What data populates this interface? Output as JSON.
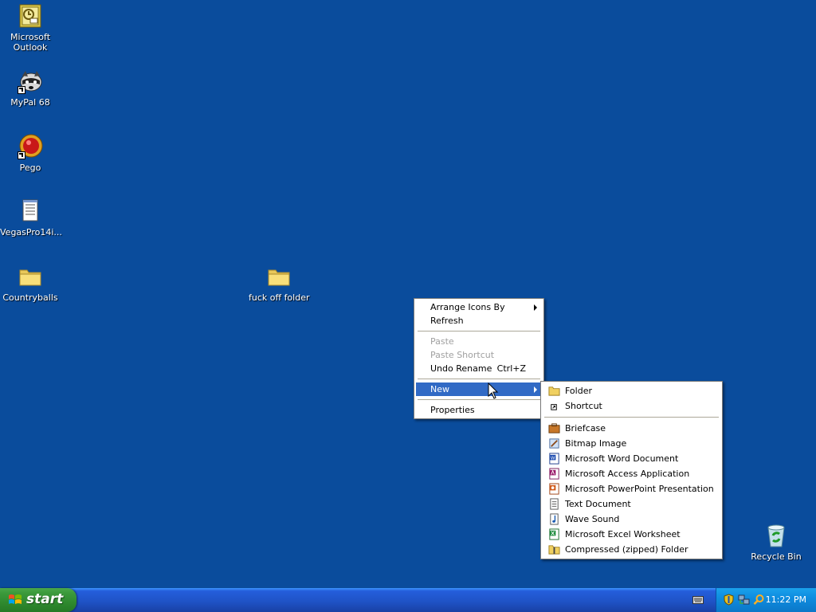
{
  "desktop": {
    "background": "#0a4c9c",
    "icons": [
      {
        "label_line1": "Microsoft",
        "label_line2": "Outlook",
        "icon": "outlook-icon"
      },
      {
        "label": "MyPal 68",
        "icon": "raccoon-icon"
      },
      {
        "label": "Pego",
        "icon": "pego-icon"
      },
      {
        "label": "VegasPro14i...",
        "icon": "text-file-icon"
      },
      {
        "label": "Countryballs",
        "icon": "folder-icon"
      },
      {
        "label": "fuck off folder",
        "icon": "folder-icon"
      },
      {
        "label": "Recycle Bin",
        "icon": "recycle-bin-icon"
      }
    ]
  },
  "context_menu": {
    "items": [
      {
        "label": "Arrange Icons By",
        "has_submenu": true
      },
      {
        "label": "Refresh"
      },
      {
        "label": "Paste",
        "disabled": true
      },
      {
        "label": "Paste Shortcut",
        "disabled": true
      },
      {
        "label": "Undo Rename",
        "shortcut": "Ctrl+Z"
      },
      {
        "label": "New",
        "has_submenu": true,
        "highlighted": true
      },
      {
        "label": "Properties"
      }
    ]
  },
  "new_submenu": {
    "items": [
      {
        "label": "Folder",
        "icon": "folder-icon"
      },
      {
        "label": "Shortcut",
        "icon": "shortcut-icon"
      },
      {
        "label": "Briefcase",
        "icon": "briefcase-icon"
      },
      {
        "label": "Bitmap Image",
        "icon": "bitmap-icon"
      },
      {
        "label": "Microsoft Word Document",
        "icon": "word-icon"
      },
      {
        "label": "Microsoft Access Application",
        "icon": "access-icon"
      },
      {
        "label": "Microsoft PowerPoint Presentation",
        "icon": "powerpoint-icon"
      },
      {
        "label": "Text Document",
        "icon": "text-document-icon"
      },
      {
        "label": "Wave Sound",
        "icon": "wave-sound-icon"
      },
      {
        "label": "Microsoft Excel Worksheet",
        "icon": "excel-icon"
      },
      {
        "label": "Compressed (zipped) Folder",
        "icon": "zip-folder-icon"
      }
    ]
  },
  "taskbar": {
    "start_label": "start",
    "clock": "11:22 PM",
    "tray_icons": [
      "security-shield-icon",
      "network-icon",
      "search-icon"
    ],
    "accent": "#245edb"
  }
}
